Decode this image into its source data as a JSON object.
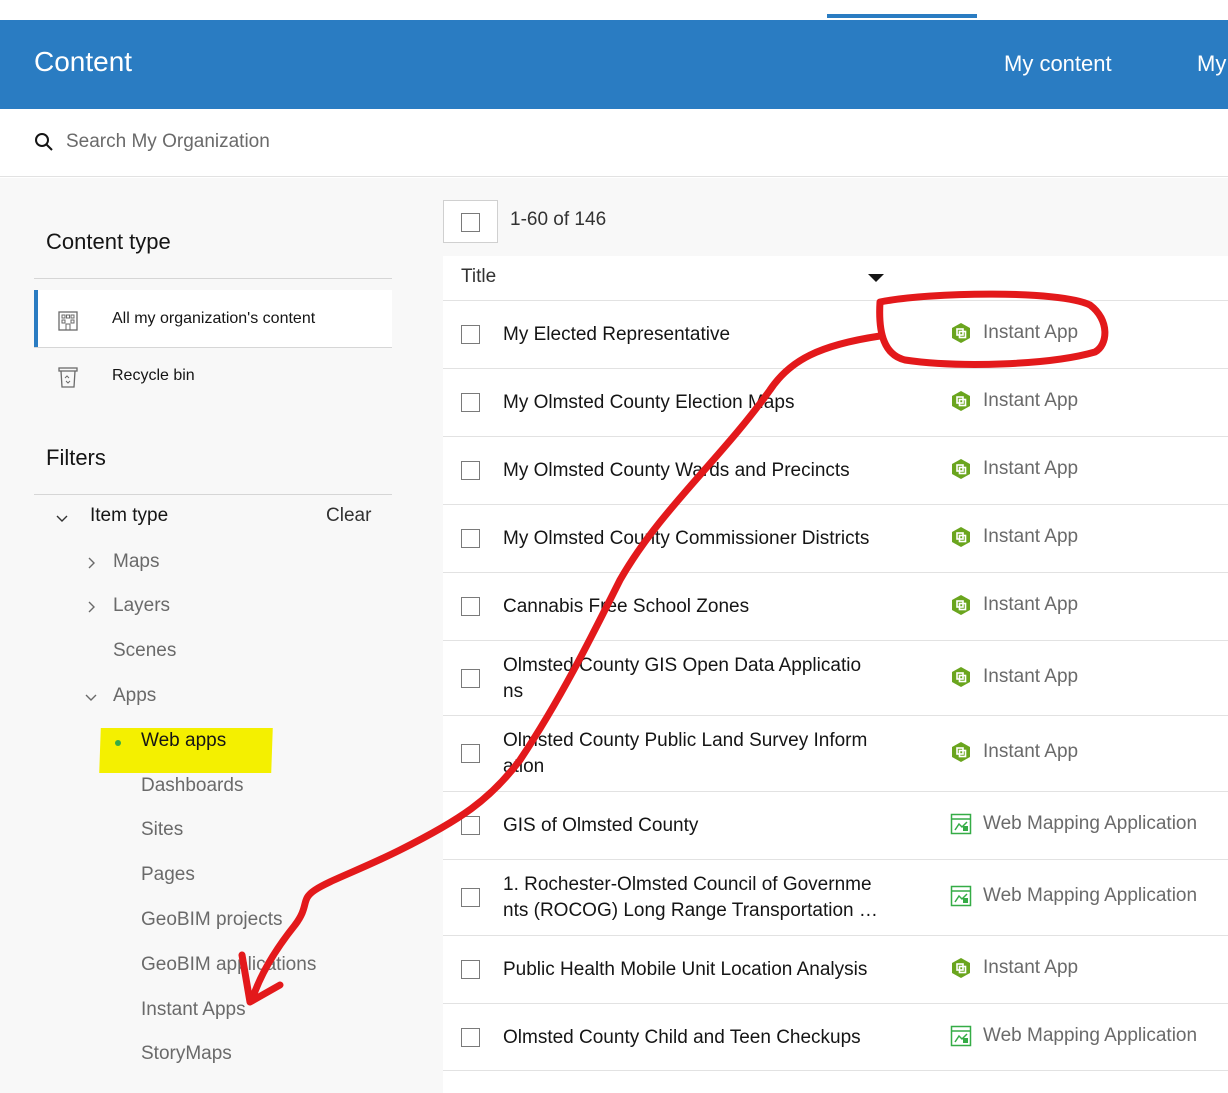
{
  "header": {
    "title": "Content",
    "nav": [
      "My content",
      "My"
    ]
  },
  "search": {
    "placeholder": "Search My Organization"
  },
  "sidebar": {
    "content_type_heading": "Content type",
    "content_types": [
      {
        "label": "All my organization's content",
        "icon": "building-icon",
        "active": true
      },
      {
        "label": "Recycle bin",
        "icon": "recycle-bin-icon",
        "active": false
      }
    ],
    "filters_heading": "Filters",
    "item_type_label": "Item type",
    "clear_label": "Clear",
    "tree": [
      {
        "label": "Maps",
        "expandable": true
      },
      {
        "label": "Layers",
        "expandable": true
      },
      {
        "label": "Scenes",
        "expandable": false
      },
      {
        "label": "Apps",
        "expandable": true,
        "expanded": true
      },
      {
        "label": "Web apps",
        "selected": true
      },
      {
        "label": "Dashboards"
      },
      {
        "label": "Sites"
      },
      {
        "label": "Pages"
      },
      {
        "label": "GeoBIM projects"
      },
      {
        "label": "GeoBIM applications"
      },
      {
        "label": "Instant Apps"
      },
      {
        "label": "StoryMaps"
      }
    ]
  },
  "results": {
    "count": "1-60 of 146",
    "title_column": "Title",
    "rows": [
      {
        "name": "My Elected Representative",
        "type": "Instant App",
        "icon": "instant-app-icon"
      },
      {
        "name": "My Olmsted County Election Maps",
        "type": "Instant App",
        "icon": "instant-app-icon"
      },
      {
        "name": "My Olmsted County Wards and Precincts",
        "type": "Instant App",
        "icon": "instant-app-icon"
      },
      {
        "name": "My Olmsted County Commissioner Districts",
        "type": "Instant App",
        "icon": "instant-app-icon"
      },
      {
        "name": "Cannabis Free School Zones",
        "type": "Instant App",
        "icon": "instant-app-icon"
      },
      {
        "name": "Olmsted County GIS Open Data Applicatio\nns",
        "type": "Instant App",
        "icon": "instant-app-icon"
      },
      {
        "name": "Olmsted County Public Land Survey Inform\nation",
        "type": "Instant App",
        "icon": "instant-app-icon"
      },
      {
        "name": "GIS of Olmsted County",
        "type": "Web Mapping Application",
        "icon": "web-mapping-app-icon"
      },
      {
        "name": "1. Rochester-Olmsted Council of Governme\nnts (ROCOG) Long Range Transportation …",
        "type": "Web Mapping Application",
        "icon": "web-mapping-app-icon"
      },
      {
        "name": "Public Health Mobile Unit Location Analysis",
        "type": "Instant App",
        "icon": "instant-app-icon"
      },
      {
        "name": "Olmsted County Child and Teen Checkups",
        "type": "Web Mapping Application",
        "icon": "web-mapping-app-icon"
      }
    ]
  },
  "colors": {
    "header_blue": "#2a7cc2",
    "instant_app_green": "#6aa51e",
    "web_map_green": "#35ac46",
    "annotation_red": "#e3191b",
    "highlight_yellow": "#f4f000"
  }
}
